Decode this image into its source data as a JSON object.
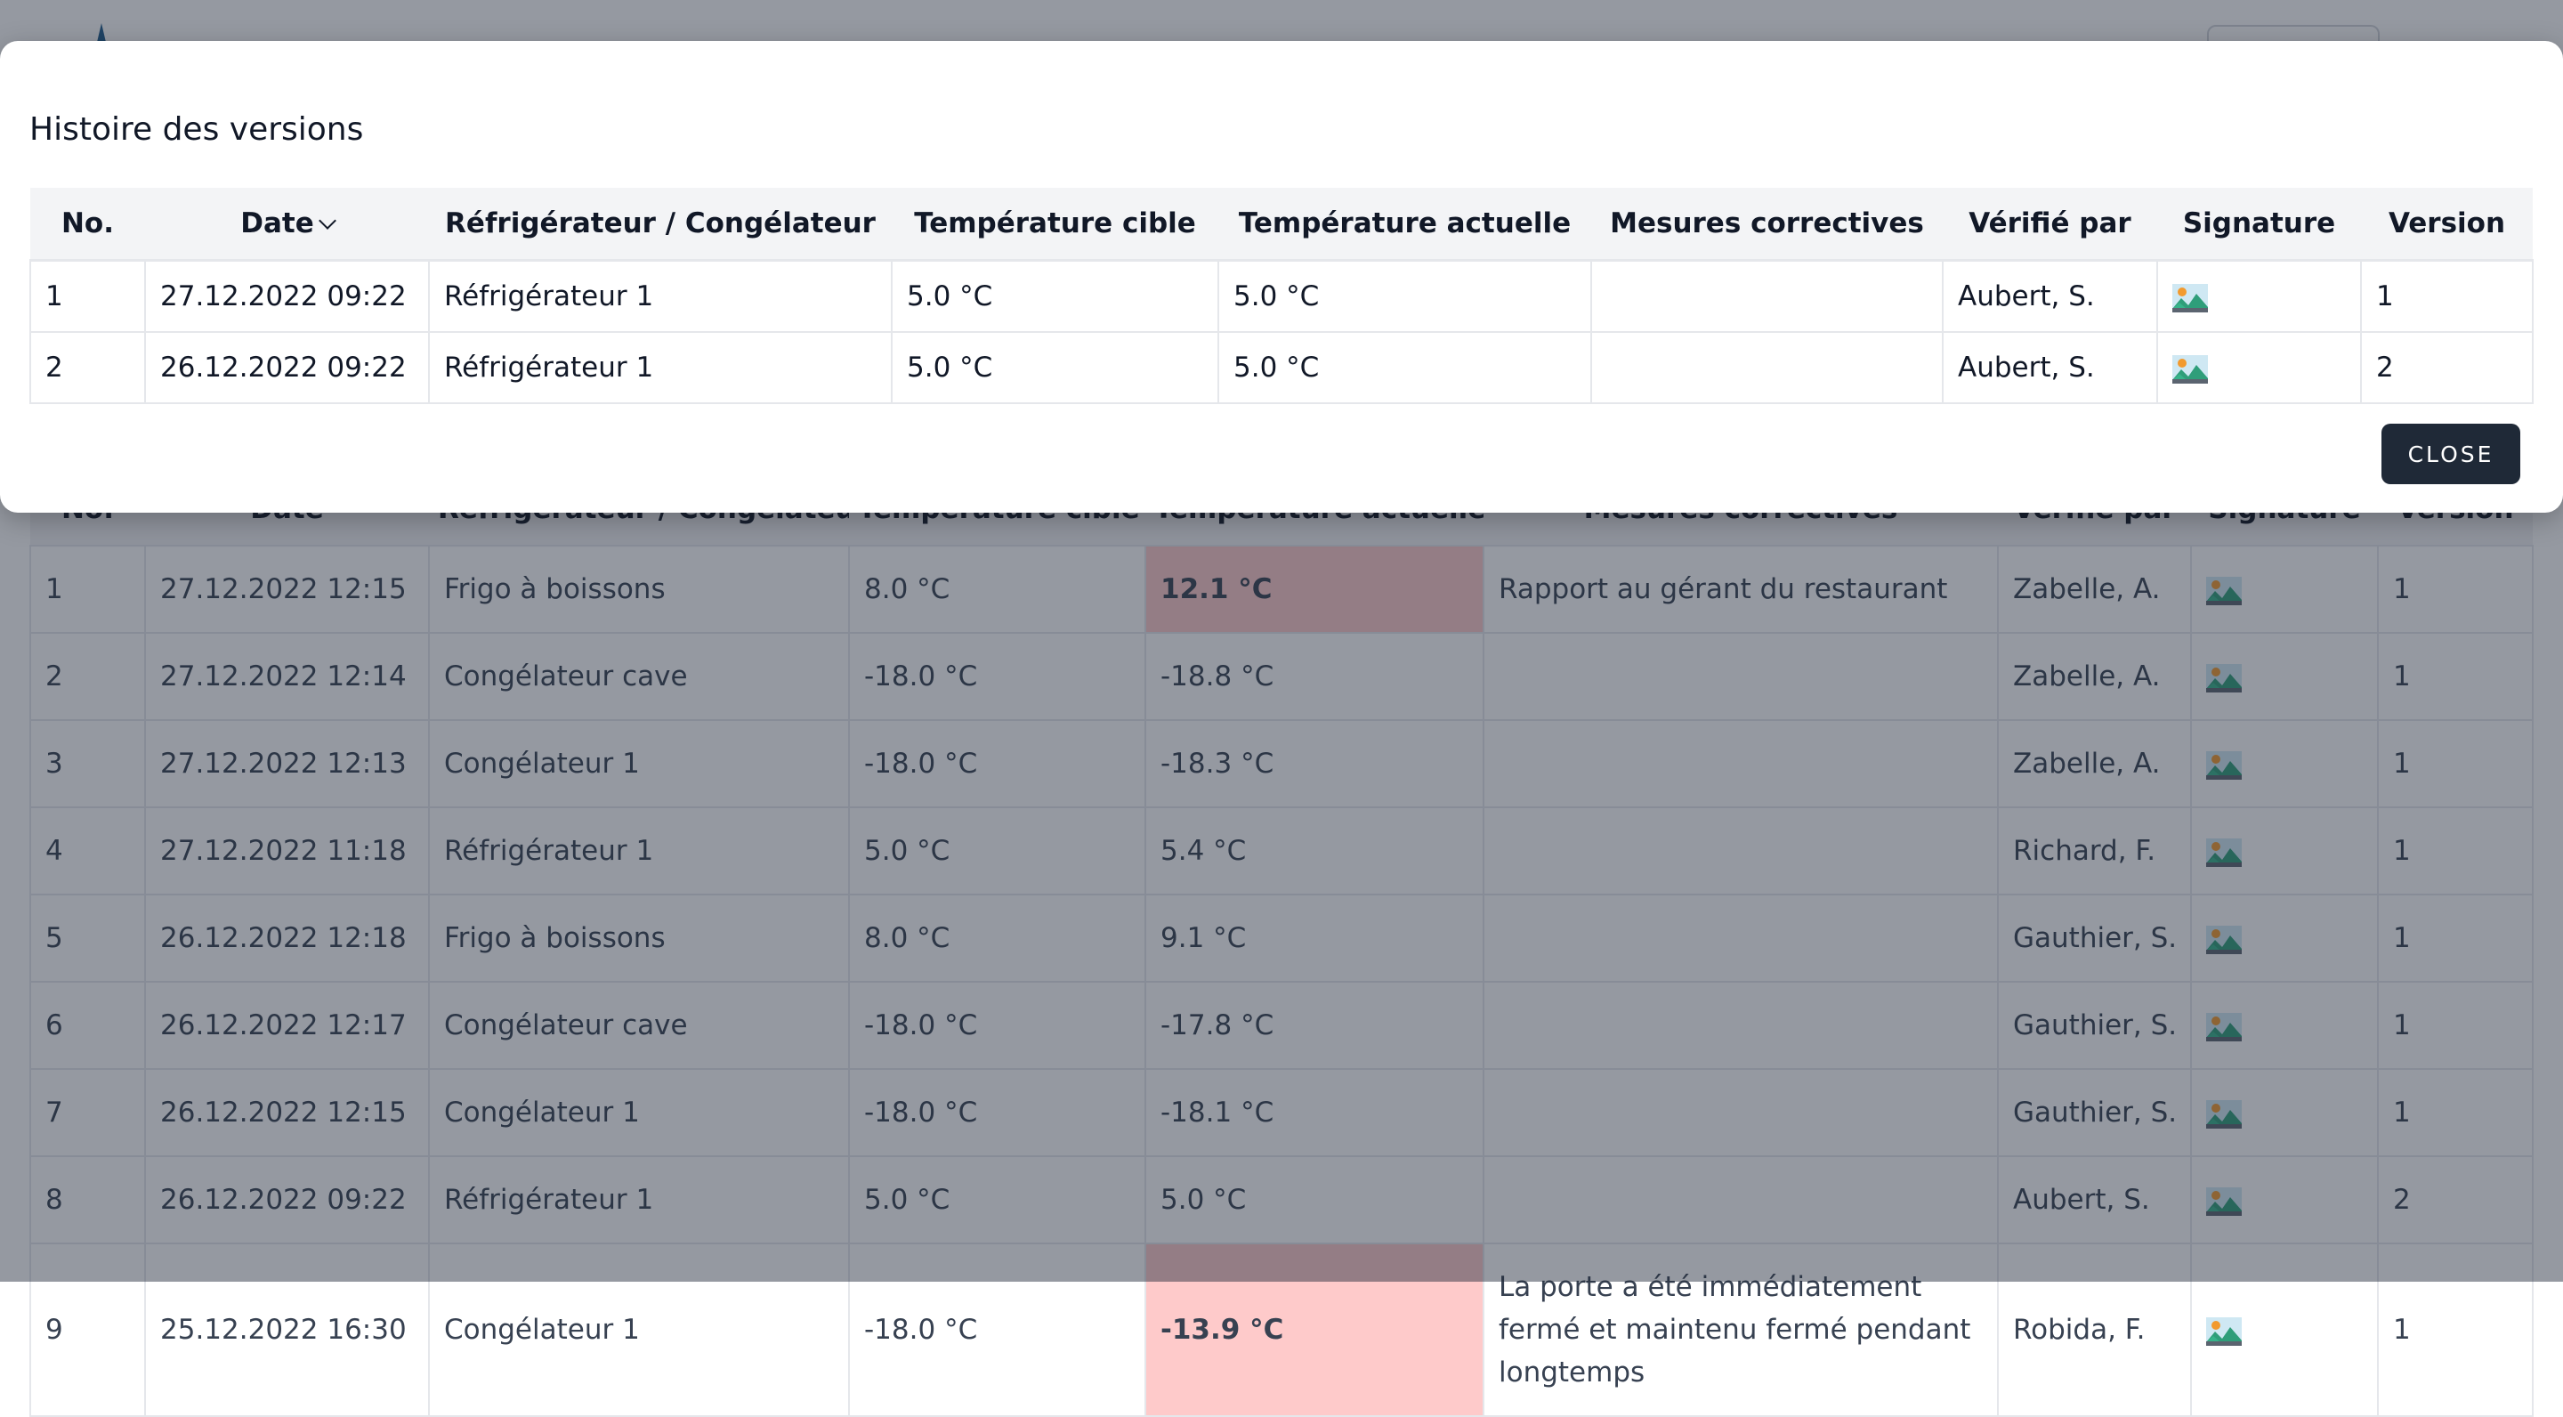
{
  "background": {
    "header_button_label": "",
    "table": {
      "columns": [
        "No.",
        "Date",
        "Réfrigérateur / Congélateur",
        "Température cible",
        "Température actuelle",
        "Mesures correctives",
        "Vérifié par",
        "Signature",
        "Version"
      ],
      "rows": [
        {
          "no": "1",
          "date": "27.12.2022 12:15",
          "unit": "Frigo à boissons",
          "target": "8.0 °C",
          "actual": "12.1 °C",
          "alert": true,
          "measures": "Rapport au gérant du restaurant",
          "verified_by": "Zabelle, A.",
          "signature": "image-icon",
          "version": "1"
        },
        {
          "no": "2",
          "date": "27.12.2022 12:14",
          "unit": "Congélateur cave",
          "target": "-18.0 °C",
          "actual": "-18.8 °C",
          "alert": false,
          "measures": "",
          "verified_by": "Zabelle, A.",
          "signature": "image-icon",
          "version": "1"
        },
        {
          "no": "3",
          "date": "27.12.2022 12:13",
          "unit": "Congélateur 1",
          "target": "-18.0 °C",
          "actual": "-18.3 °C",
          "alert": false,
          "measures": "",
          "verified_by": "Zabelle, A.",
          "signature": "image-icon",
          "version": "1"
        },
        {
          "no": "4",
          "date": "27.12.2022 11:18",
          "unit": "Réfrigérateur 1",
          "target": "5.0 °C",
          "actual": "5.4 °C",
          "alert": false,
          "measures": "",
          "verified_by": "Richard, F.",
          "signature": "image-icon",
          "version": "1"
        },
        {
          "no": "5",
          "date": "26.12.2022 12:18",
          "unit": "Frigo à boissons",
          "target": "8.0 °C",
          "actual": "9.1 °C",
          "alert": false,
          "measures": "",
          "verified_by": "Gauthier, S.",
          "signature": "image-icon",
          "version": "1"
        },
        {
          "no": "6",
          "date": "26.12.2022 12:17",
          "unit": "Congélateur cave",
          "target": "-18.0 °C",
          "actual": "-17.8 °C",
          "alert": false,
          "measures": "",
          "verified_by": "Gauthier, S.",
          "signature": "image-icon",
          "version": "1"
        },
        {
          "no": "7",
          "date": "26.12.2022 12:15",
          "unit": "Congélateur 1",
          "target": "-18.0 °C",
          "actual": "-18.1 °C",
          "alert": false,
          "measures": "",
          "verified_by": "Gauthier, S.",
          "signature": "image-icon",
          "version": "1"
        },
        {
          "no": "8",
          "date": "26.12.2022 09:22",
          "unit": "Réfrigérateur 1",
          "target": "5.0 °C",
          "actual": "5.0 °C",
          "alert": false,
          "measures": "",
          "verified_by": "Aubert, S.",
          "signature": "image-icon",
          "version": "2"
        },
        {
          "no": "9",
          "date": "25.12.2022 16:30",
          "unit": "Congélateur 1",
          "target": "-18.0 °C",
          "actual": "-13.9 °C",
          "alert": true,
          "measures": "La porte a été immédiatement fermé et maintenu fermé pendant longtemps",
          "verified_by": "Robida, F.",
          "signature": "image-icon",
          "version": "1"
        }
      ]
    }
  },
  "modal": {
    "title": "Histoire des versions",
    "columns": [
      "No.",
      "Date",
      "Réfrigérateur / Congélateur",
      "Température cible",
      "Température actuelle",
      "Mesures correctives",
      "Vérifié par",
      "Signature",
      "Version"
    ],
    "sort_column": "Date",
    "sort_icon": "chevron-down-icon",
    "rows": [
      {
        "no": "1",
        "date": "27.12.2022 09:22",
        "unit": "Réfrigérateur 1",
        "target": "5.0 °C",
        "actual": "5.0 °C",
        "measures": "",
        "verified_by": "Aubert, S.",
        "signature": "image-icon",
        "version": "1"
      },
      {
        "no": "2",
        "date": "26.12.2022 09:22",
        "unit": "Réfrigérateur 1",
        "target": "5.0 °C",
        "actual": "5.0 °C",
        "measures": "",
        "verified_by": "Aubert, S.",
        "signature": "image-icon",
        "version": "2"
      }
    ],
    "close_label": "CLOSE"
  },
  "colors": {
    "alert_cell": "#fecaca",
    "button_dark": "#1f2937",
    "header_bg": "#f3f4f6"
  }
}
